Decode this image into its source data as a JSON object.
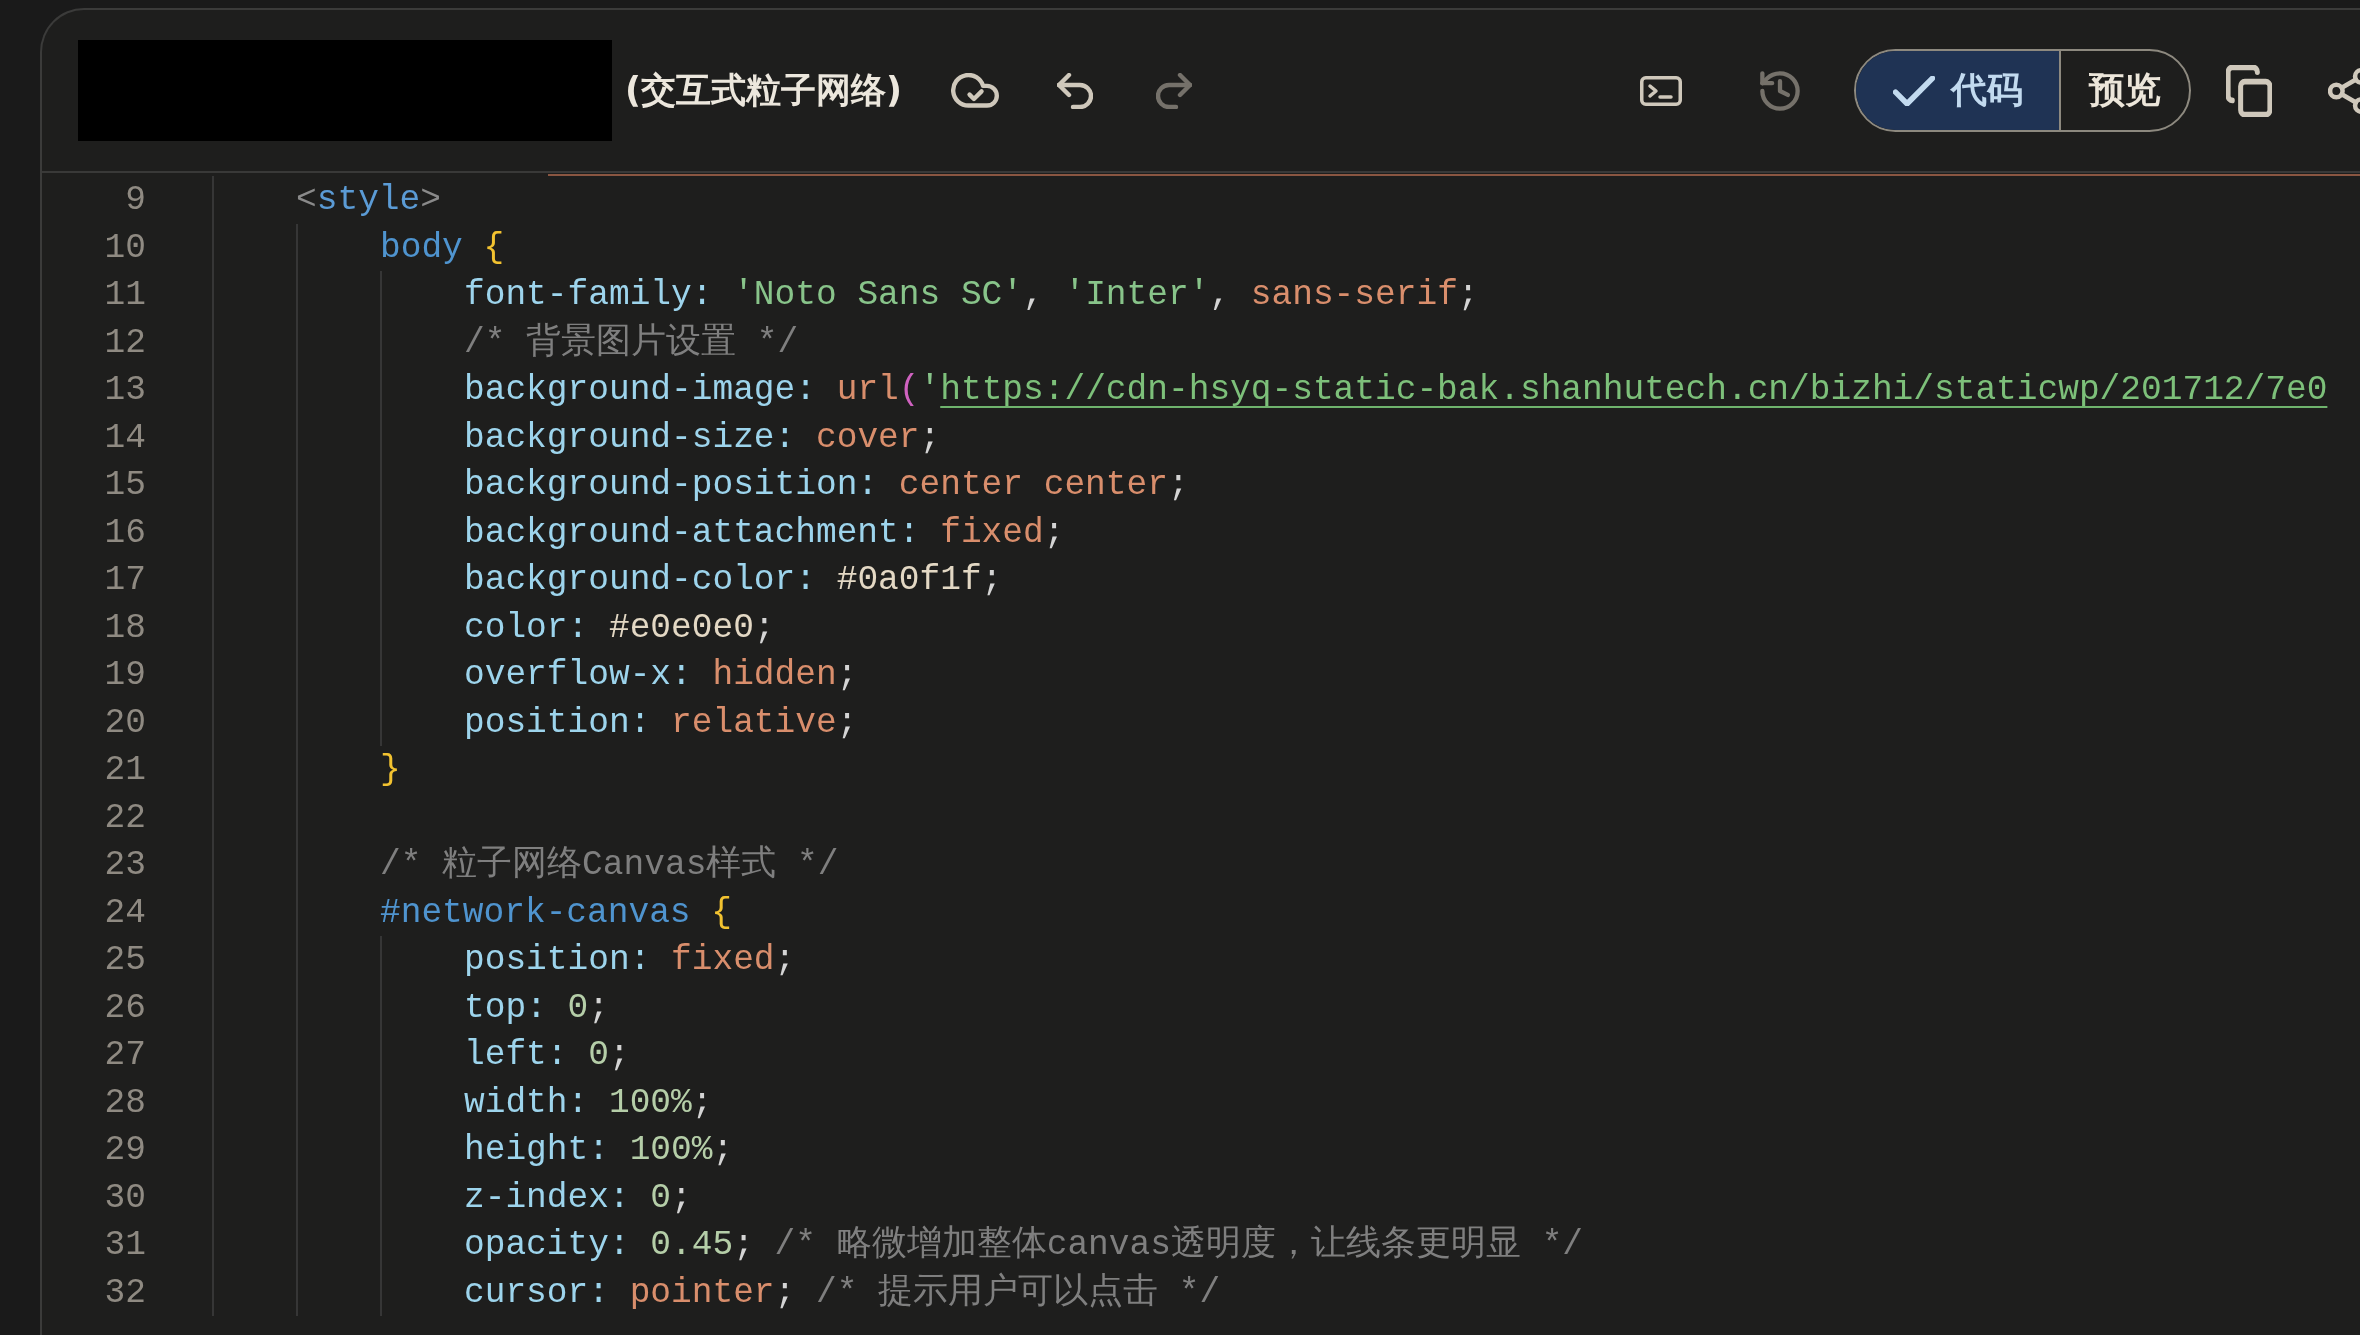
{
  "header": {
    "title": "(交互式粒子网络)",
    "toolbar_left": [
      {
        "kind": "sync",
        "disabled": false
      },
      {
        "kind": "undo",
        "disabled": false
      },
      {
        "kind": "redo",
        "disabled": true
      }
    ],
    "toolbar_right": [
      {
        "kind": "terminal",
        "disabled": false
      },
      {
        "kind": "history",
        "disabled": true
      }
    ],
    "view_toggle": [
      {
        "label": "代码",
        "selected": true
      },
      {
        "label": "预览",
        "selected": false
      }
    ],
    "actions": [
      {
        "kind": "copy"
      },
      {
        "kind": "share"
      }
    ]
  },
  "editor": {
    "lines": [
      {
        "number": "9",
        "tokens": [
          {
            "kind": "tag_bracket",
            "text": "<"
          },
          {
            "kind": "tag",
            "text": "style"
          },
          {
            "kind": "tag_bracket",
            "text": ">"
          }
        ],
        "children": [
          {
            "number": "10",
            "tokens": [
              {
                "kind": "selector",
                "text": "body"
              },
              {
                "kind": "brace",
                "text": " {"
              }
            ],
            "children": [
              {
                "number": "11",
                "tokens": [
                  {
                    "kind": "property",
                    "text": "font-family:"
                  },
                  {
                    "kind": "string",
                    "text": " 'Noto Sans SC'"
                  },
                  {
                    "kind": "punct",
                    "text": ","
                  },
                  {
                    "kind": "string",
                    "text": " 'Inter'"
                  },
                  {
                    "kind": "punct",
                    "text": ","
                  },
                  {
                    "kind": "value",
                    "text": " sans-serif"
                  },
                  {
                    "kind": "punct",
                    "text": ";"
                  }
                ]
              },
              {
                "number": "12",
                "tokens": [
                  {
                    "kind": "comment",
                    "text": "/* 背景图片设置 */"
                  }
                ]
              },
              {
                "number": "13",
                "tokens": [
                  {
                    "kind": "property",
                    "text": "background-image:"
                  },
                  {
                    "kind": "value",
                    "text": " url"
                  },
                  {
                    "kind": "paren",
                    "text": "("
                  },
                  {
                    "kind": "string",
                    "text": "'"
                  },
                  {
                    "kind": "link",
                    "text": "https://cdn-hsyq-static-bak.shanhutech.cn/bizhi/staticwp/201712/7e0"
                  }
                ]
              },
              {
                "number": "14",
                "tokens": [
                  {
                    "kind": "property",
                    "text": "background-size:"
                  },
                  {
                    "kind": "value",
                    "text": " cover"
                  },
                  {
                    "kind": "punct",
                    "text": ";"
                  }
                ]
              },
              {
                "number": "15",
                "tokens": [
                  {
                    "kind": "property",
                    "text": "background-position:"
                  },
                  {
                    "kind": "value",
                    "text": " center center"
                  },
                  {
                    "kind": "punct",
                    "text": ";"
                  }
                ]
              },
              {
                "number": "16",
                "tokens": [
                  {
                    "kind": "property",
                    "text": "background-attachment:"
                  },
                  {
                    "kind": "value",
                    "text": " fixed"
                  },
                  {
                    "kind": "punct",
                    "text": ";"
                  }
                ]
              },
              {
                "number": "17",
                "tokens": [
                  {
                    "kind": "property",
                    "text": "background-color:"
                  },
                  {
                    "kind": "hex",
                    "text": " #0a0f1f"
                  },
                  {
                    "kind": "punct",
                    "text": ";"
                  }
                ]
              },
              {
                "number": "18",
                "tokens": [
                  {
                    "kind": "property",
                    "text": "color:"
                  },
                  {
                    "kind": "hex",
                    "text": " #e0e0e0"
                  },
                  {
                    "kind": "punct",
                    "text": ";"
                  }
                ]
              },
              {
                "number": "19",
                "tokens": [
                  {
                    "kind": "property",
                    "text": "overflow-x:"
                  },
                  {
                    "kind": "value",
                    "text": " hidden"
                  },
                  {
                    "kind": "punct",
                    "text": ";"
                  }
                ]
              },
              {
                "number": "20",
                "tokens": [
                  {
                    "kind": "property",
                    "text": "position:"
                  },
                  {
                    "kind": "value",
                    "text": " relative"
                  },
                  {
                    "kind": "punct",
                    "text": ";"
                  }
                ]
              }
            ]
          },
          {
            "number": "21",
            "tokens": [
              {
                "kind": "brace",
                "text": "}"
              }
            ]
          },
          {
            "number": "22"
          },
          {
            "number": "23",
            "tokens": [
              {
                "kind": "comment",
                "text": "/* 粒子网络Canvas样式 */"
              }
            ]
          },
          {
            "number": "24",
            "tokens": [
              {
                "kind": "selector",
                "text": "#network-canvas"
              },
              {
                "kind": "brace",
                "text": " {"
              }
            ],
            "children": [
              {
                "number": "25",
                "tokens": [
                  {
                    "kind": "property",
                    "text": "position:"
                  },
                  {
                    "kind": "value",
                    "text": " fixed"
                  },
                  {
                    "kind": "punct",
                    "text": ";"
                  }
                ]
              },
              {
                "number": "26",
                "tokens": [
                  {
                    "kind": "property",
                    "text": "top:"
                  },
                  {
                    "kind": "number",
                    "text": " 0"
                  },
                  {
                    "kind": "punct",
                    "text": ";"
                  }
                ]
              },
              {
                "number": "27",
                "tokens": [
                  {
                    "kind": "property",
                    "text": "left:"
                  },
                  {
                    "kind": "number",
                    "text": " 0"
                  },
                  {
                    "kind": "punct",
                    "text": ";"
                  }
                ]
              },
              {
                "number": "28",
                "tokens": [
                  {
                    "kind": "property",
                    "text": "width:"
                  },
                  {
                    "kind": "number",
                    "text": " 100%"
                  },
                  {
                    "kind": "punct",
                    "text": ";"
                  }
                ]
              },
              {
                "number": "29",
                "tokens": [
                  {
                    "kind": "property",
                    "text": "height:"
                  },
                  {
                    "kind": "number",
                    "text": " 100%"
                  },
                  {
                    "kind": "punct",
                    "text": ";"
                  }
                ]
              },
              {
                "number": "30",
                "tokens": [
                  {
                    "kind": "property",
                    "text": "z-index:"
                  },
                  {
                    "kind": "number",
                    "text": " 0"
                  },
                  {
                    "kind": "punct",
                    "text": ";"
                  }
                ]
              },
              {
                "number": "31",
                "tokens": [
                  {
                    "kind": "property",
                    "text": "opacity:"
                  },
                  {
                    "kind": "number",
                    "text": " 0.45"
                  },
                  {
                    "kind": "punct",
                    "text": ";"
                  },
                  {
                    "kind": "comment",
                    "text": " /* 略微增加整体canvas透明度，让线条更明显 */"
                  }
                ]
              },
              {
                "number": "32",
                "tokens": [
                  {
                    "kind": "property",
                    "text": "cursor:"
                  },
                  {
                    "kind": "value",
                    "text": " pointer"
                  },
                  {
                    "kind": "punct",
                    "text": ";"
                  },
                  {
                    "kind": "comment",
                    "text": " /* 提示用户可以点击 */"
                  }
                ]
              }
            ]
          }
        ]
      }
    ]
  }
}
